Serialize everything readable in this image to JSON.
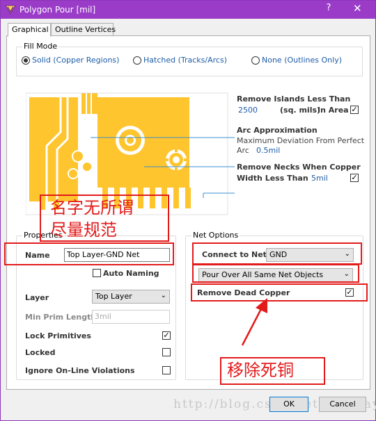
{
  "window": {
    "title": "Polygon Pour [mil]",
    "help": "?",
    "close": "✕"
  },
  "tabs": [
    {
      "label": "Graphical",
      "active": true
    },
    {
      "label": "Outline Vertices",
      "active": false
    }
  ],
  "fill_mode": {
    "title": "Fill Mode",
    "options": [
      {
        "label": "Solid (Copper Regions)",
        "selected": true
      },
      {
        "label": "Hatched (Tracks/Arcs)",
        "selected": false
      },
      {
        "label": "None (Outlines Only)",
        "selected": false
      }
    ]
  },
  "graphic": {
    "remove_islands_title": "Remove Islands Less Than",
    "remove_islands_value": "2500",
    "remove_islands_units": "(sq. mils)",
    "remove_islands_in_area": "In Area",
    "remove_islands_checked": true,
    "arc_title": "Arc Approximation",
    "arc_desc": "Maximum Deviation From Perfect",
    "arc_label": "Arc",
    "arc_value": "0.5mil",
    "necks_title": "Remove Necks When Copper",
    "necks_width_label": "Width Less Than",
    "necks_value": "5mil",
    "necks_checked": true
  },
  "properties": {
    "title": "Properties",
    "name_label": "Name",
    "name_value": "Top Layer-GND Net",
    "auto_naming_label": "Auto Naming",
    "auto_naming_checked": false,
    "layer_label": "Layer",
    "layer_value": "Top Layer",
    "min_prim_label": "Min Prim Length",
    "min_prim_value": "3mil",
    "lock_primitives_label": "Lock Primitives",
    "lock_primitives_checked": true,
    "locked_label": "Locked",
    "locked_checked": false,
    "ignore_label": "Ignore On-Line Violations",
    "ignore_checked": false
  },
  "net_options": {
    "title": "Net Options",
    "connect_label": "Connect to Net",
    "connect_value": "GND",
    "pour_value": "Pour Over All Same Net Objects",
    "remove_dead_label": "Remove Dead Copper",
    "remove_dead_checked": true
  },
  "annotations": {
    "name_note_line1": "名字无所谓",
    "name_note_line2": "尽量规范",
    "remove_note": "移除死铜"
  },
  "buttons": {
    "ok": "OK",
    "cancel": "Cancel"
  },
  "watermark": "http://blog.csdn.net/Recclay",
  "colors": {
    "title_bar": "#9b3cc9",
    "copper": "#ffc52e",
    "annotation_red": "#e21a1a",
    "link_blue": "#1e5ca8"
  }
}
